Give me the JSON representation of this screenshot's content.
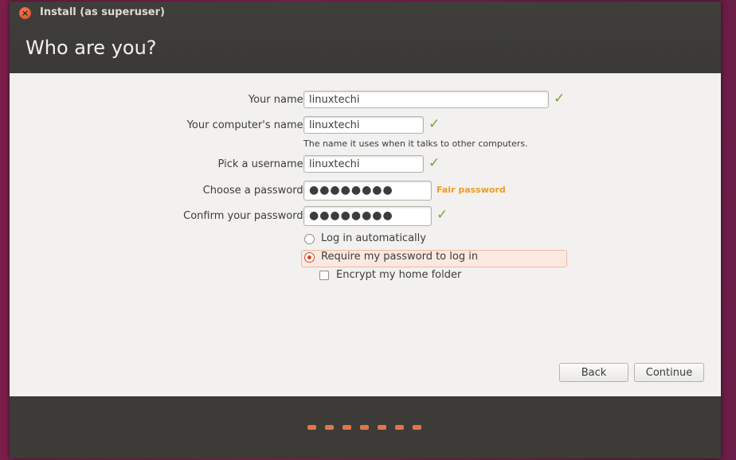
{
  "window": {
    "title": "Install (as superuser)",
    "close_glyph": "×"
  },
  "page": {
    "title": "Who are you?"
  },
  "form": {
    "name_label": "Your name:",
    "name_value": "linuxtechi",
    "computer_label": "Your computer's name:",
    "computer_value": "linuxtechi",
    "computer_hint": "The name it uses when it talks to other computers.",
    "username_label": "Pick a username:",
    "username_value": "linuxtechi",
    "password_label": "Choose a password:",
    "password_value": "●●●●●●●●",
    "password_strength": "Fair password",
    "confirm_label": "Confirm your password:",
    "confirm_value": "●●●●●●●●",
    "check_glyph": "✓"
  },
  "options": {
    "login_auto": "Log in automatically",
    "require_password": "Require my password to log in",
    "encrypt_home": "Encrypt my home folder",
    "selected": "require_password"
  },
  "buttons": {
    "back": "Back",
    "continue": "Continue"
  },
  "progress": {
    "total_steps": 7
  },
  "colors": {
    "accent": "#d14b25",
    "check_green": "#77a32d",
    "strength_orange": "#f29b1f"
  }
}
